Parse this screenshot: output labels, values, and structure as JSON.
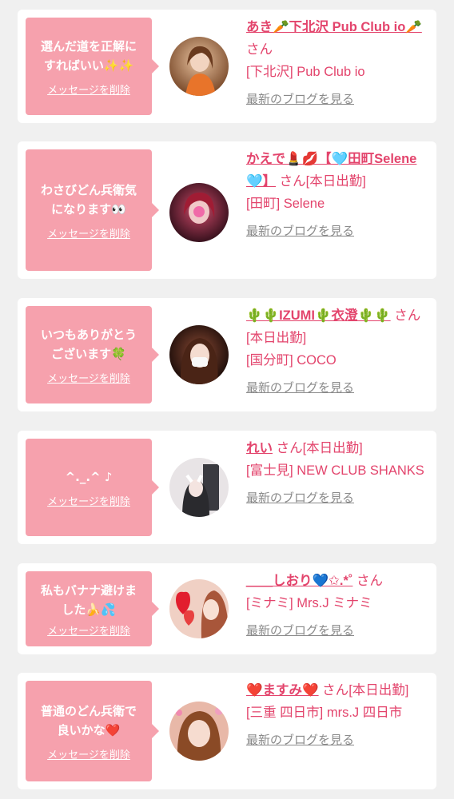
{
  "messages": [
    {
      "bubble_text": "選んだ道を正解に\nすればいい✨✨",
      "delete_label": "メッセージを削除",
      "cast_name": "あき🥕下北沢 Pub Club io🥕",
      "san_label": " さん",
      "status": "",
      "shop": "[下北沢] Pub Club io",
      "blog_label": "最新のブログを見る",
      "avatar_colors": [
        "#d8a070",
        "#8a5a3a"
      ]
    },
    {
      "bubble_text": "わさびどん兵衛気\nになります👀",
      "delete_label": "メッセージを削除",
      "cast_name": "かえで💄💋【🩵田町Selene🩵】",
      "san_label": " さん",
      "status": "[本日出勤]",
      "shop": "[田町] Selene",
      "blog_label": "最新のブログを見る",
      "avatar_colors": [
        "#b0324a",
        "#3a1420"
      ]
    },
    {
      "bubble_text": "いつもありがとう\nございます🍀",
      "delete_label": "メッセージを削除",
      "cast_name": "🌵🌵IZUMI🌵衣澄🌵🌵",
      "san_label": " さん",
      "status": "[本日出勤]",
      "shop": "[国分町] COCO",
      "blog_label": "最新のブログを見る",
      "avatar_colors": [
        "#6a3a2a",
        "#1a0c0a"
      ]
    },
    {
      "bubble_text": "^._.^ ♪",
      "delete_label": "メッセージを削除",
      "cast_name": "れい",
      "san_label": " さん",
      "status": "[本日出勤]",
      "shop": "[富士見] NEW CLUB SHANKS",
      "blog_label": "最新のブログを見る",
      "avatar_colors": [
        "#e6e2e4",
        "#2a2a2e"
      ]
    },
    {
      "bubble_text": "私もバナナ避けま\nした🍌💦",
      "delete_label": "メッセージを削除",
      "cast_name": "＿＿しおり💙✩.*˚",
      "san_label": " さん",
      "status": "",
      "shop": "[ミナミ] Mrs.J ミナミ",
      "blog_label": "最新のブログを見る",
      "avatar_colors": [
        "#e23a3a",
        "#f2c8b8"
      ]
    },
    {
      "bubble_text": "普通のどん兵衛で\n良いかな❤️",
      "delete_label": "メッセージを削除",
      "cast_name": "❤️ますみ❤️",
      "san_label": " さん",
      "status": "[本日出勤]",
      "shop": "[三重 四日市] mrs.J 四日市",
      "blog_label": "最新のブログを見る",
      "avatar_colors": [
        "#c88a6a",
        "#f0b0c0"
      ]
    }
  ]
}
